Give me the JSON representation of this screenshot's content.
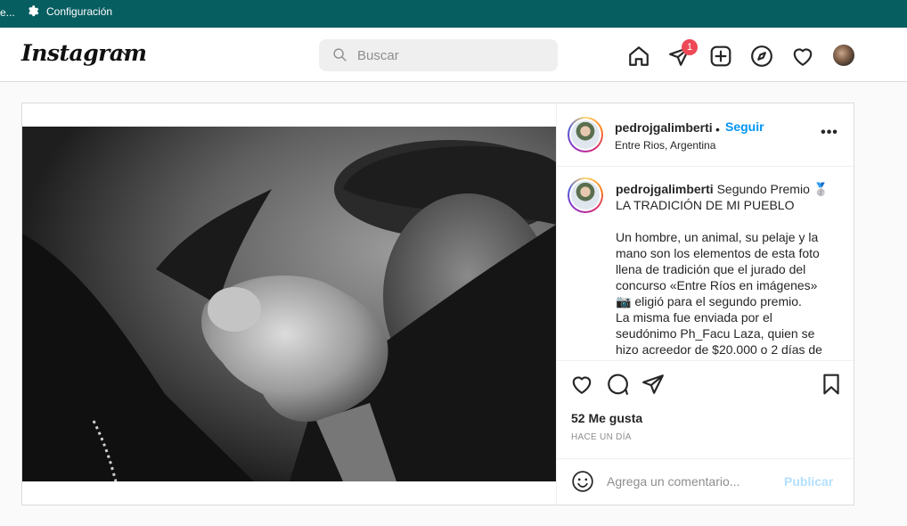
{
  "topbar": {
    "ellipsis": "e...",
    "settings_label": "Configuración"
  },
  "header": {
    "logo": "Instagram",
    "search_placeholder": "Buscar",
    "notification_count": "1",
    "icons": [
      "home-icon",
      "direct-icon",
      "new-post-icon",
      "explore-icon",
      "activity-icon",
      "profile-avatar"
    ]
  },
  "post": {
    "username": "pedrojgalimberti",
    "separator": "•",
    "follow_label": "Seguir",
    "location": "Entre Rios, Argentina",
    "more_label": "•••",
    "caption_user": "pedrojgalimberti",
    "caption_lines": [
      "Segundo Premio 🥈",
      "LA TRADICIÓN DE MI PUEBLO",
      "",
      "Un hombre, un animal, su pelaje y la",
      "mano son los elementos de esta foto",
      "llena de tradición que el jurado del",
      "concurso «Entre Ríos en imágenes»",
      "📷 eligió para el segundo premio.",
      "La misma fue enviada por el",
      "seudónimo Ph_Facu Laza, quien se",
      "hizo acreedor de $20.000 o 2 días de"
    ],
    "likes": "52 Me gusta",
    "time": "HACE UN DÍA",
    "comment_placeholder": "Agrega un comentario...",
    "publish_label": "Publicar"
  },
  "colors": {
    "topbar": "#075e61",
    "link": "#0095f6",
    "badge": "#ed4956",
    "publish_disabled": "#b2dffc"
  }
}
